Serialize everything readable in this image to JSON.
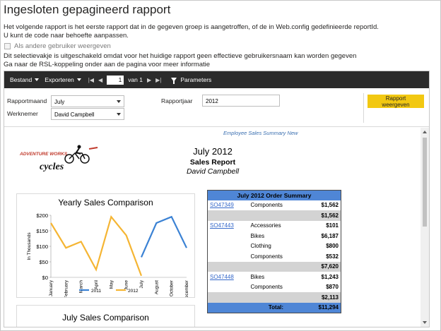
{
  "page": {
    "title": "Ingesloten gepagineerd rapport",
    "desc1": "Het volgende rapport is het eerste rapport dat in de gegeven groep is aangetroffen, of de in Web.config gedefinieerde reportId.",
    "desc2": "U kunt de code naar behoefte aanpassen.",
    "checkbox_label": "Als andere gebruiker weergeven",
    "note1": "Dit selectievakje is uitgeschakeld omdat voor het huidige rapport geen effectieve gebruikersnaam kan worden gegeven",
    "note2": "Ga naar de RSL-koppeling onder aan de pagina voor meer informatie"
  },
  "toolbar": {
    "bestand": "Bestand",
    "exporteren": "Exporteren",
    "page_value": "1",
    "page_of": "van 1",
    "parameters": "Parameters"
  },
  "params": {
    "month_label": "Rapportmaand",
    "month_value": "July",
    "employee_label": "Werknemer",
    "employee_value": "David Campbell",
    "year_label": "Rapportjaar",
    "year_value": "2012",
    "view_button": "Rapport weergeven"
  },
  "report": {
    "link": "Employee Sales Summary New",
    "logo_top": "ADVENTURE WORKS",
    "logo_bottom": "cycles",
    "head_date": "July  2012",
    "head_title": "Sales Report",
    "head_name": "David Campbell",
    "chart_title": "Yearly Sales Comparison",
    "chart2_title": "July  Sales Comparison",
    "order_summary": {
      "title": "July 2012 Order Summary",
      "rows": [
        {
          "type": "item",
          "order": "SO47349",
          "product": "Components",
          "amount": "$1,562"
        },
        {
          "type": "subtotal",
          "order": "",
          "product": "",
          "amount": "$1,562"
        },
        {
          "type": "item",
          "order": "SO47443",
          "product": "Accessories",
          "amount": "$101"
        },
        {
          "type": "item",
          "order": "",
          "product": "Bikes",
          "amount": "$6,187"
        },
        {
          "type": "item",
          "order": "",
          "product": "Clothing",
          "amount": "$800"
        },
        {
          "type": "item",
          "order": "",
          "product": "Components",
          "amount": "$532"
        },
        {
          "type": "subtotal",
          "order": "",
          "product": "",
          "amount": "$7,620"
        },
        {
          "type": "item",
          "order": "SO47448",
          "product": "Bikes",
          "amount": "$1,243"
        },
        {
          "type": "item",
          "order": "",
          "product": "Components",
          "amount": "$870"
        },
        {
          "type": "subtotal",
          "order": "",
          "product": "",
          "amount": "$2,113"
        },
        {
          "type": "total",
          "order": "",
          "product": "Total:",
          "amount": "$11,294"
        }
      ]
    }
  },
  "colors": {
    "toolbar_bg": "#2b2b2b",
    "button_yellow": "#f2c811",
    "series_2011": "#3b82d4",
    "series_2012": "#f5b533",
    "table_header": "#4f86d6"
  },
  "chart_data": {
    "type": "line",
    "title": "Yearly Sales Comparison",
    "ylabel": "In Thousands",
    "ylim": [
      0,
      200
    ],
    "yticks": [
      "$0",
      "$50",
      "$100",
      "$150",
      "$200"
    ],
    "categories": [
      "January",
      "February",
      "March",
      "April",
      "May",
      "June",
      "July",
      "August",
      "October",
      "December"
    ],
    "series": [
      {
        "name": "2011",
        "values": [
          null,
          null,
          null,
          null,
          null,
          null,
          65,
          175,
          195,
          95
        ]
      },
      {
        "name": "2012",
        "values": [
          175,
          95,
          115,
          25,
          195,
          135,
          5,
          null,
          null,
          null
        ]
      }
    ],
    "legend": "bottom"
  }
}
